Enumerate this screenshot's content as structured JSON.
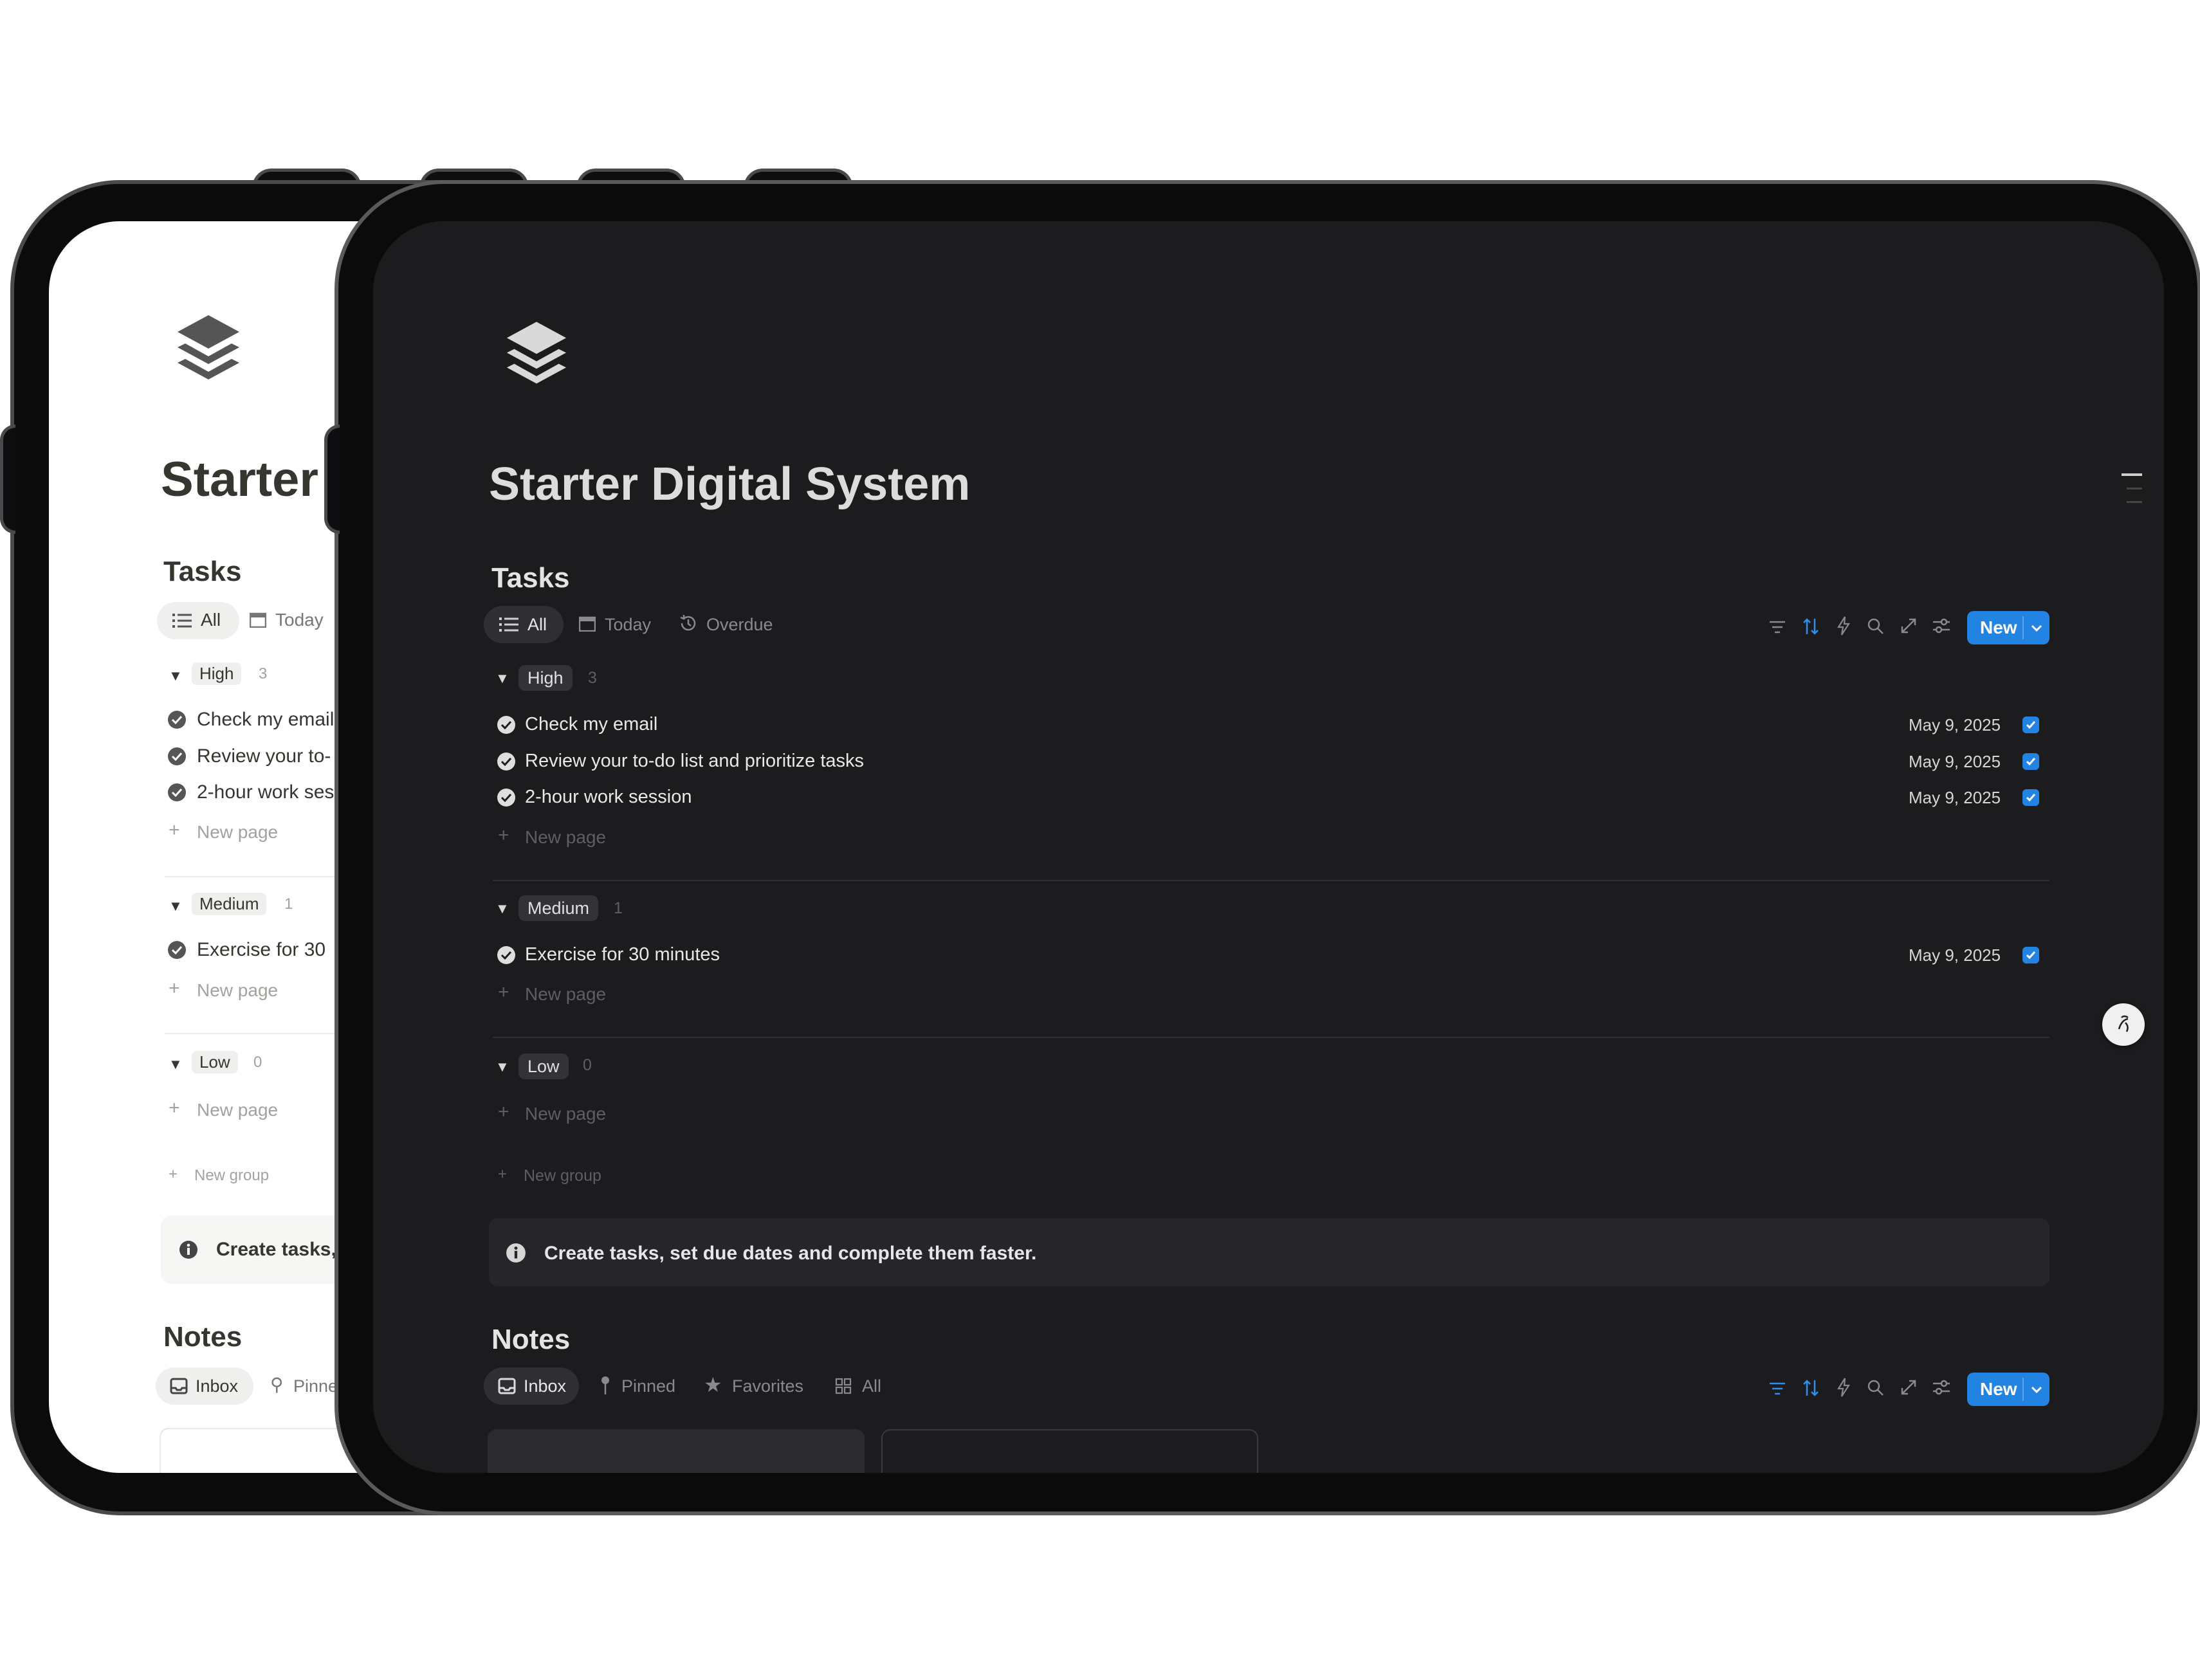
{
  "page": {
    "title": "Starter Digital System",
    "title_short": "Starter"
  },
  "tasks": {
    "heading": "Tasks",
    "views": [
      "All",
      "Today",
      "Overdue"
    ],
    "active_view": "All",
    "new_label": "New",
    "groups": [
      {
        "label": "High",
        "count": "3",
        "items": [
          {
            "title": "Check my email",
            "date": "May 9, 2025",
            "done": true
          },
          {
            "title": "Review your to-do list and prioritize tasks",
            "date": "May 9, 2025",
            "done": true
          },
          {
            "title": "2-hour work session",
            "date": "May 9, 2025",
            "done": true
          }
        ]
      },
      {
        "label": "Medium",
        "count": "1",
        "items": [
          {
            "title": "Exercise for 30 minutes",
            "date": "May 9, 2025",
            "done": true
          }
        ]
      },
      {
        "label": "Low",
        "count": "0",
        "items": []
      }
    ],
    "new_page_label": "New page",
    "new_group_label": "New group",
    "callout": "Create tasks, set due dates and complete them faster."
  },
  "back_screen": {
    "items_truncated": [
      "Check my email",
      "Review your to-",
      "2-hour work ses",
      "Exercise for 30"
    ],
    "callout_truncated": "Create tasks,",
    "notes_pinned_truncated": "Pinne"
  },
  "notes": {
    "heading": "Notes",
    "views": [
      "Inbox",
      "Pinned",
      "Favorites",
      "All"
    ],
    "active_view": "Inbox",
    "new_label": "New"
  },
  "colors": {
    "accent": "#2383e2",
    "dark_bg": "#1c1b1e",
    "light_bg": "#ffffff"
  },
  "icons": [
    "layers-logo-icon",
    "list-icon",
    "calendar-icon",
    "history-icon",
    "filter-icon",
    "sort-icon",
    "lightning-icon",
    "search-icon",
    "expand-icon",
    "settings-icon",
    "check-circle-icon",
    "plus-icon",
    "info-icon",
    "inbox-icon",
    "pin-icon",
    "star-icon",
    "grid-icon",
    "help-icon"
  ]
}
